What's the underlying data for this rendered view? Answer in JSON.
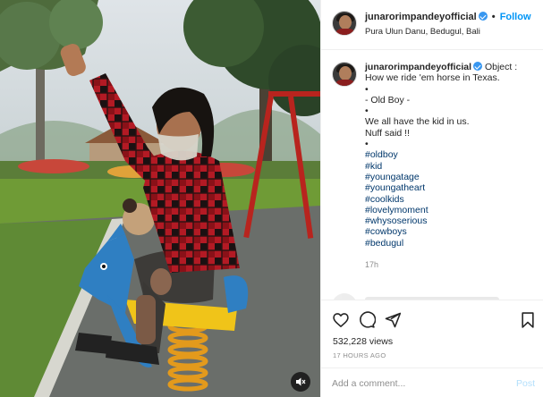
{
  "post": {
    "username": "junarorimpandeyofficial",
    "location": "Pura Ulun Danu, Bedugul, Bali",
    "follow_label": "Follow",
    "separator": "•"
  },
  "caption": {
    "username": "junarorimpandeyofficial",
    "lines": [
      "Object :",
      "How we ride 'em horse in Texas.",
      "•",
      "- Old Boy -",
      "•",
      "We all have the kid in us.",
      "Nuff said !!",
      "•"
    ],
    "hashtags": [
      "#oldboy",
      "#kid",
      "#youngatage",
      "#youngatheart",
      "#coolkids",
      "#lovelymoment",
      "#whysoserious",
      "#cowboys",
      "#bedugul"
    ],
    "age": "17h"
  },
  "stats": {
    "views": "532,228 views",
    "posted": "17 HOURS AGO"
  },
  "comment_box": {
    "placeholder": "Add a comment...",
    "post_label": "Post"
  },
  "icons": {
    "like": "heart-icon",
    "comment": "comment-icon",
    "share": "send-icon",
    "save": "bookmark-icon",
    "mute": "muted-speaker-icon"
  },
  "colors": {
    "follow": "#0095f6",
    "hashtag": "#00376b",
    "verified": "#3897f0",
    "post_disabled": "#b2dffc"
  }
}
